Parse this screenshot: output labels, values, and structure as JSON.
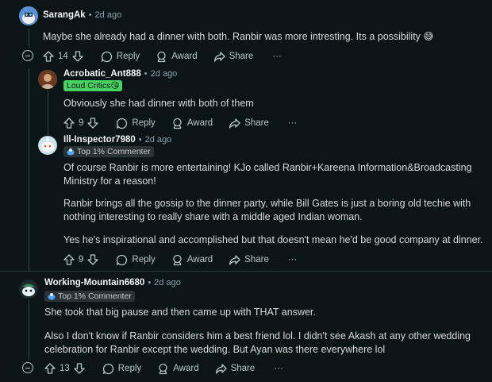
{
  "comments": [
    {
      "author": "SarangAk",
      "time": "2d ago",
      "paragraphs": [
        "Maybe she already had a dinner with both. Ranbir was more intresting. Its a possibility 😅"
      ],
      "votes": "14",
      "reply": "Reply",
      "award": "Award",
      "share": "Share",
      "more": "···"
    },
    {
      "author": "Acrobatic_Ant888",
      "time": "2d ago",
      "flair": "Loud Critics",
      "paragraphs": [
        "Obviously she had dinner with both of them"
      ],
      "votes": "9",
      "reply": "Reply",
      "award": "Award",
      "share": "Share",
      "more": "···"
    },
    {
      "author": "Ill-Inspector7980",
      "time": "2d ago",
      "flair": "Top 1% Commenter",
      "paragraphs": [
        "Of course Ranbir is more entertaining! KJo called Ranbir+Kareena Information&Broadcasting Ministry for a reason!",
        "Ranbir brings all the gossip to the dinner party, while Bill Gates is just a boring old techie with nothing interesting to really share with a middle aged Indian woman.",
        "Yes he's inspirational and accomplished but that doesn't mean he'd be good company at dinner."
      ],
      "votes": "9",
      "reply": "Reply",
      "award": "Award",
      "share": "Share",
      "more": "···"
    },
    {
      "author": "Working-Mountain6680",
      "time": "2d ago",
      "flair": "Top 1% Commenter",
      "paragraphs": [
        "She took that big pause and then came up with THAT answer.",
        "Also I don't know if Ranbir considers him a best friend lol. I didn't see Akash at any other wedding celebration for Ranbir except the wedding. But Ayan was there everywhere lol"
      ],
      "votes": "13",
      "reply": "Reply",
      "award": "Award",
      "share": "Share",
      "more": "···"
    }
  ],
  "bullet": "•",
  "colors": {
    "background": "#0b1416",
    "flair_green": "#46d160",
    "thread_line": "#33464c"
  }
}
